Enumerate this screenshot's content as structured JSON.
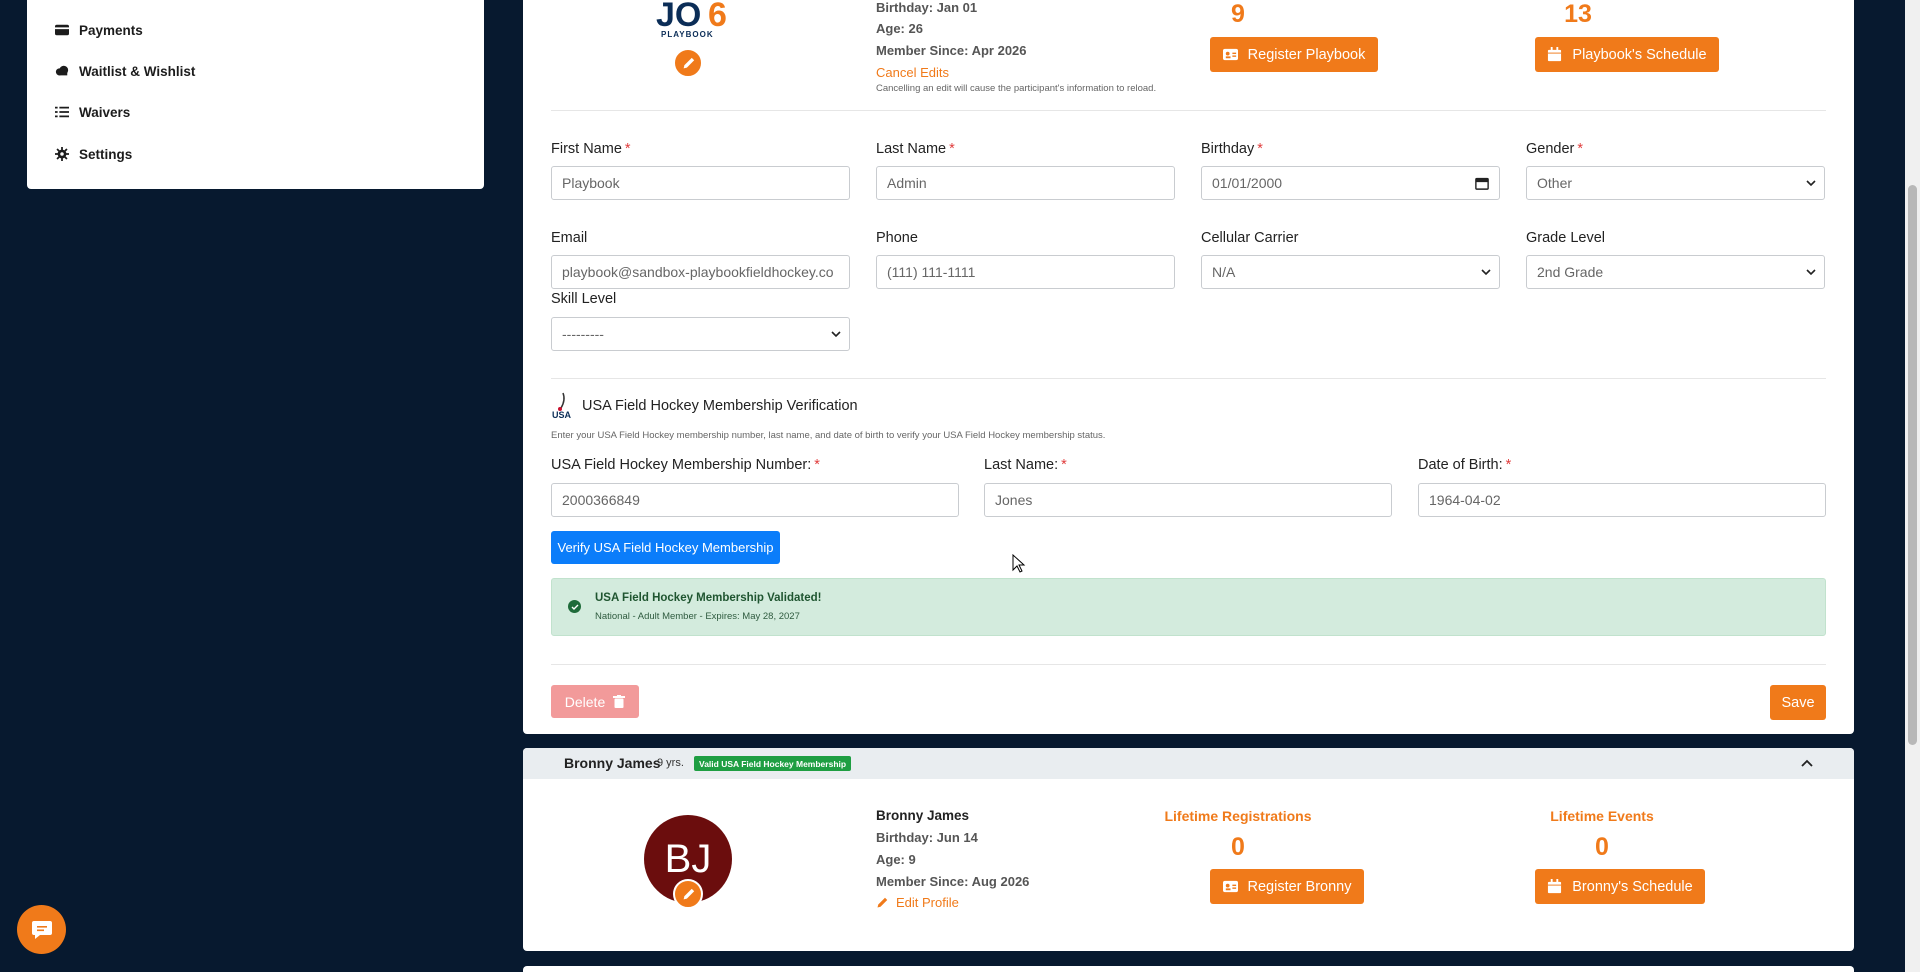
{
  "sidebar": {
    "items": [
      {
        "label": "Payments",
        "icon": "credit-card-icon"
      },
      {
        "label": "Waitlist & Wishlist",
        "icon": "cloud-icon"
      },
      {
        "label": "Waivers",
        "icon": "list-check-icon"
      },
      {
        "label": "Settings",
        "icon": "gear-icon"
      }
    ]
  },
  "participant": {
    "logo_text": "PLAYBOOK",
    "birthday": "Birthday: Jan 01",
    "age": "Age: 26",
    "member_since": "Member Since: Apr 2026",
    "cancel_edits": "Cancel Edits",
    "cancel_note": "Cancelling an edit will cause the participant's information to reload.",
    "registrations_count": "9",
    "events_count": "13",
    "register_button": "Register Playbook",
    "schedule_button": "Playbook's Schedule"
  },
  "form": {
    "first_name_label": "First Name",
    "first_name": "Playbook",
    "last_name_label": "Last Name",
    "last_name": "Admin",
    "birthday_label": "Birthday",
    "birthday": "01/01/2000",
    "gender_label": "Gender",
    "gender": "Other",
    "email_label": "Email",
    "email": "playbook@sandbox-playbookfieldhockey.co",
    "phone_label": "Phone",
    "phone": "(111) 111-1111",
    "carrier_label": "Cellular Carrier",
    "carrier": "N/A",
    "grade_label": "Grade Level",
    "grade": "2nd Grade",
    "skill_label": "Skill Level",
    "skill": "---------",
    "required_mark": "*"
  },
  "usa": {
    "logo_text": "USA",
    "title": "USA Field Hockey Membership Verification",
    "subtitle": "Enter your USA Field Hockey membership number, last name, and date of birth to verify your USA Field Hockey membership status.",
    "number_label": "USA Field Hockey Membership Number:",
    "number": "2000366849",
    "last_name_label": "Last Name:",
    "last_name": "Jones",
    "dob_label": "Date of Birth:",
    "dob": "1964-04-02",
    "verify_button": "Verify USA Field Hockey Membership",
    "validated_title": "USA Field Hockey Membership Validated!",
    "validated_detail": "National - Adult Member - Expires: May 28, 2027"
  },
  "actions": {
    "delete": "Delete",
    "save": "Save"
  },
  "second": {
    "header_name": "Bronny James",
    "header_age": "9 yrs.",
    "badge": "Valid USA Field Hockey Membership",
    "initials": "BJ",
    "name": "Bronny James",
    "birthday": "Birthday: Jun 14",
    "age": "Age: 9",
    "member_since": "Member Since: Aug 2026",
    "edit_profile": "Edit Profile",
    "lifetime_reg_label": "Lifetime Registrations",
    "lifetime_reg": "0",
    "lifetime_events_label": "Lifetime Events",
    "lifetime_events": "0",
    "register_button": "Register Bronny",
    "schedule_button": "Bronny's Schedule"
  },
  "colors": {
    "accent": "#f07a1a",
    "background": "#07192f",
    "primary_blue": "#0b7dfa",
    "success_bg": "#d3ebdd"
  }
}
